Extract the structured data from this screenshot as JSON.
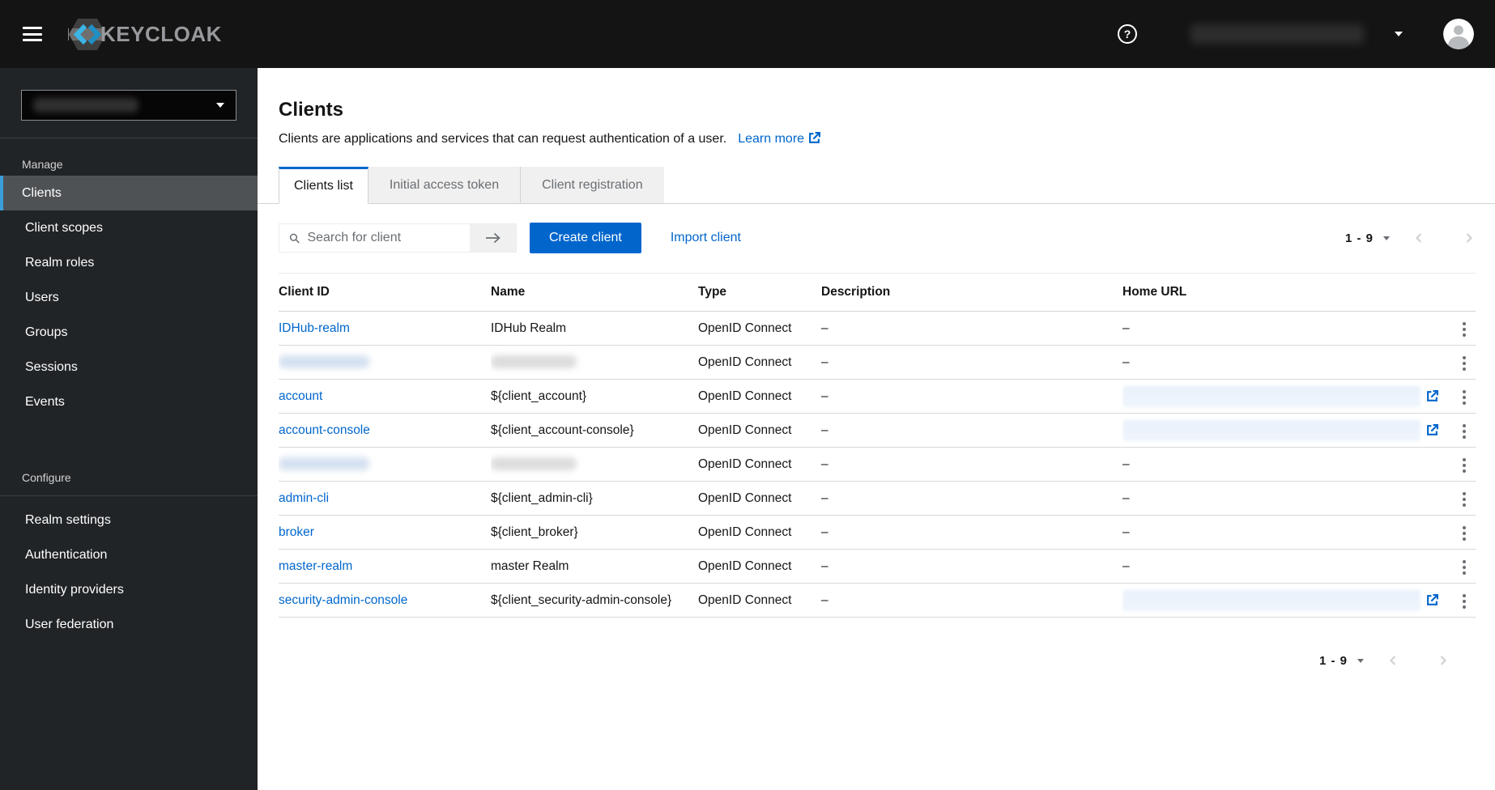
{
  "header": {
    "brand": "KEYCLOAK",
    "help_label": "?",
    "user": {
      "name_redacted": true
    }
  },
  "sidebar": {
    "realm_selector": {
      "value_redacted": true
    },
    "sections": [
      {
        "label": "Manage",
        "items": [
          {
            "label": "Clients",
            "active": true
          },
          {
            "label": "Client scopes",
            "active": false
          },
          {
            "label": "Realm roles",
            "active": false
          },
          {
            "label": "Users",
            "active": false
          },
          {
            "label": "Groups",
            "active": false
          },
          {
            "label": "Sessions",
            "active": false
          },
          {
            "label": "Events",
            "active": false
          }
        ]
      },
      {
        "label": "Configure",
        "items": [
          {
            "label": "Realm settings",
            "active": false
          },
          {
            "label": "Authentication",
            "active": false
          },
          {
            "label": "Identity providers",
            "active": false
          },
          {
            "label": "User federation",
            "active": false
          }
        ]
      }
    ]
  },
  "page": {
    "title": "Clients",
    "description": "Clients are applications and services that can request authentication of a user.",
    "learn_more_label": "Learn more",
    "tabs": [
      {
        "label": "Clients list",
        "active": true
      },
      {
        "label": "Initial access token",
        "active": false
      },
      {
        "label": "Client registration",
        "active": false
      }
    ],
    "toolbar": {
      "search_placeholder": "Search for client",
      "create_button_label": "Create client",
      "import_link_label": "Import client"
    },
    "pagination": {
      "range": "1 - 9"
    },
    "table": {
      "columns": [
        "Client ID",
        "Name",
        "Type",
        "Description",
        "Home URL"
      ],
      "empty_value": "–",
      "rows": [
        {
          "client_id": "IDHub-realm",
          "name": "IDHub Realm",
          "type": "OpenID Connect",
          "description": "–",
          "home_url": "–"
        },
        {
          "client_id_redacted": true,
          "name_redacted": true,
          "type": "OpenID Connect",
          "description": "–",
          "home_url": "–"
        },
        {
          "client_id": "account",
          "name": "${client_account}",
          "type": "OpenID Connect",
          "description": "–",
          "home_url_redacted": true
        },
        {
          "client_id": "account-console",
          "name": "${client_account-console}",
          "type": "OpenID Connect",
          "description": "–",
          "home_url_redacted": true
        },
        {
          "client_id_redacted": true,
          "name_redacted": true,
          "type": "OpenID Connect",
          "description": "–",
          "home_url": "–"
        },
        {
          "client_id": "admin-cli",
          "name": "${client_admin-cli}",
          "type": "OpenID Connect",
          "description": "–",
          "home_url": "–"
        },
        {
          "client_id": "broker",
          "name": "${client_broker}",
          "type": "OpenID Connect",
          "description": "–",
          "home_url": "–"
        },
        {
          "client_id": "master-realm",
          "name": "master Realm",
          "type": "OpenID Connect",
          "description": "–",
          "home_url": "–"
        },
        {
          "client_id": "security-admin-console",
          "name": "${client_security-admin-console}",
          "type": "OpenID Connect",
          "description": "–",
          "home_url_redacted": true
        }
      ]
    }
  },
  "colors": {
    "link": "#0066cc",
    "primary_button": "#0066cc",
    "masthead_bg": "#141414",
    "sidebar_bg": "#212427",
    "active_nav_indicator": "#3a9fd9",
    "active_tab_indicator": "#0066cc"
  }
}
